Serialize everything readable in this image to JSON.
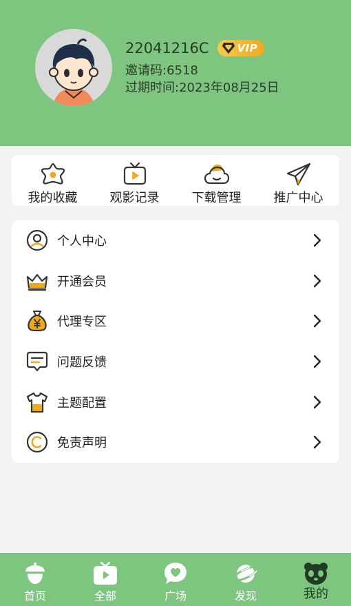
{
  "profile": {
    "username": "22041216C",
    "vip_badge": "VIP",
    "invite_code": "邀请码:6518",
    "expire": "过期时间:2023年08月25日"
  },
  "quick_actions": [
    {
      "label": "我的收藏",
      "icon": "star-icon"
    },
    {
      "label": "观影记录",
      "icon": "tv-icon"
    },
    {
      "label": "下载管理",
      "icon": "cloud-icon"
    },
    {
      "label": "推广中心",
      "icon": "paper-plane-icon"
    }
  ],
  "menu": [
    {
      "label": "个人中心",
      "icon": "user-icon"
    },
    {
      "label": "开通会员",
      "icon": "crown-icon"
    },
    {
      "label": "代理专区",
      "icon": "money-bag-icon"
    },
    {
      "label": "问题反馈",
      "icon": "feedback-icon"
    },
    {
      "label": "主题配置",
      "icon": "tshirt-icon"
    },
    {
      "label": "免责声明",
      "icon": "copyright-icon"
    }
  ],
  "tabbar": [
    {
      "label": "首页",
      "icon": "acorn-icon"
    },
    {
      "label": "全部",
      "icon": "tv-play-icon"
    },
    {
      "label": "广场",
      "icon": "chat-heart-icon"
    },
    {
      "label": "发现",
      "icon": "planet-icon"
    },
    {
      "label": "我的",
      "icon": "panda-icon",
      "active": true
    }
  ],
  "colors": {
    "brand_green": "#7ec57f",
    "accent_orange": "#f0a91d",
    "active_tab_text": "#1f3d22"
  }
}
